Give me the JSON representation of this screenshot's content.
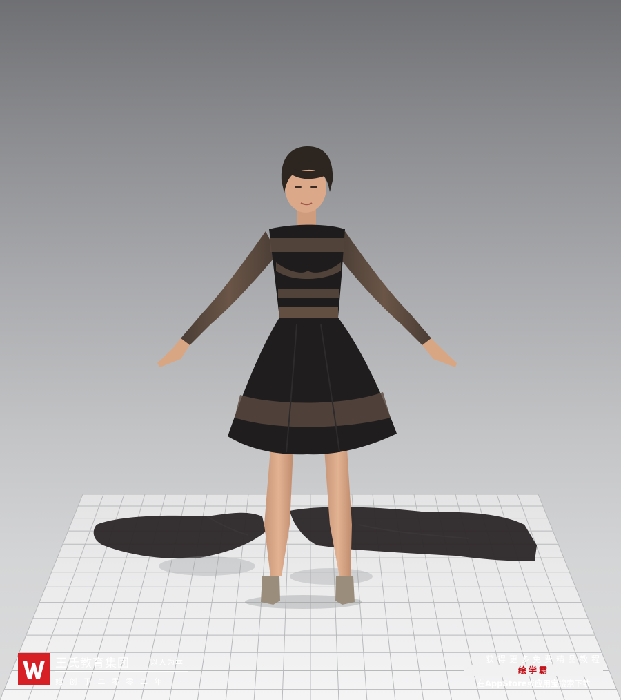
{
  "viewport": {
    "background_top": "#6f7073",
    "background_bottom": "#dcdcdd",
    "floor_grid_color": "#b9babc",
    "floor_color": "#f2f2f3"
  },
  "avatar": {
    "garment": "black long-sleeve flared dress with sheer stripes",
    "garment_color": "#1e1c1d",
    "sheer_color": "#5b4a40",
    "skin_color": "#d9a684",
    "hair_color": "#2c2520",
    "shoe_color": "#9a8d7c"
  },
  "floor_garment": {
    "description": "flattened black gown pattern on floor",
    "color": "#2a2627"
  },
  "watermark": {
    "brand_name": "王氏教育集团",
    "slogan": "以人为本",
    "founded": "始创于二零零二年",
    "accent_color": "#d71f26"
  },
  "promo": {
    "top_text": "获得更多免费精品教程",
    "banner": "绘学霸",
    "bottom_prefix": "在",
    "bottom_store1": "AppStore",
    "bottom_mid": "或",
    "bottom_store2": "应用宝",
    "bottom_suffix": "搜索下载",
    "banner_color": "#c0141c"
  }
}
